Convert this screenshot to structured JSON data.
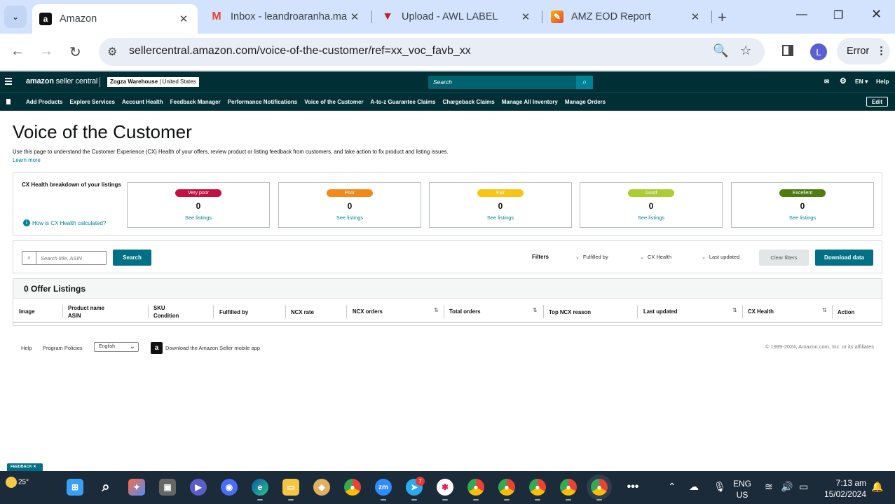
{
  "browser": {
    "tabs": [
      {
        "title": "Amazon",
        "icon": "amazon-icon",
        "active": true
      },
      {
        "title": "Inbox - leandroaranha.ma",
        "icon": "gmail-icon",
        "active": false
      },
      {
        "title": "Upload - AWL LABEL",
        "icon": "awl-icon",
        "active": false
      },
      {
        "title": "AMZ EOD Report",
        "icon": "sheets-icon",
        "active": false
      }
    ],
    "url": "sellercentral.amazon.com/voice-of-the-customer/ref=xx_voc_favb_xx",
    "profile_initial": "L",
    "error_label": "Error"
  },
  "header": {
    "logo_bold": "amazon",
    "logo_rest": " seller central",
    "store_name": "Zogza Warehouse",
    "store_region": " | United States",
    "search_placeholder": "Search",
    "lang": "EN",
    "help": "Help"
  },
  "nav": {
    "items": [
      "Add Products",
      "Explore Services",
      "Account Health",
      "Feedback Manager",
      "Performance Notifications",
      "Voice of the Customer",
      "A-to-z Guarantee Claims",
      "Chargeback Claims",
      "Manage All Inventory",
      "Manage Orders"
    ],
    "edit": "Edit"
  },
  "page": {
    "title": "Voice of the Customer",
    "description": "Use this page to understand the Customer Experience (CX) Health of your offers, review product or listing feedback from customers, and take action to fix product and listing issues.",
    "learn_more": "Learn more"
  },
  "health": {
    "label": "CX Health breakdown of your listings",
    "how_link": "How is CX Health calculated?",
    "cards": [
      {
        "label": "Very poor",
        "value": "0",
        "link": "See listings",
        "color": "#c40f41"
      },
      {
        "label": "Poor",
        "value": "0",
        "link": "See listings",
        "color": "#f3891a"
      },
      {
        "label": "Fair",
        "value": "0",
        "link": "See listings",
        "color": "#f7c614"
      },
      {
        "label": "Good",
        "value": "0",
        "link": "See listings",
        "color": "#a9cd32"
      },
      {
        "label": "Excellent",
        "value": "0",
        "link": "See listings",
        "color": "#4d7c0f"
      }
    ]
  },
  "filters": {
    "search_placeholder": "Search title, ASIN",
    "search_button": "Search",
    "label": "Filters",
    "dropdowns": [
      "Fulfilled by",
      "CX Health",
      "Last updated"
    ],
    "clear": "Clear filters",
    "download": "Download data"
  },
  "listings": {
    "title": "0 Offer Listings",
    "columns": [
      {
        "line1": "Image",
        "line2": ""
      },
      {
        "line1": "Product name",
        "line2": "ASIN"
      },
      {
        "line1": "SKU",
        "line2": "Condition"
      },
      {
        "line1": "Fulfilled by",
        "line2": ""
      },
      {
        "line1": "NCX rate",
        "line2": ""
      },
      {
        "line1": "NCX orders",
        "line2": ""
      },
      {
        "line1": "Total orders",
        "line2": ""
      },
      {
        "line1": "Top NCX reason",
        "line2": ""
      },
      {
        "line1": "Last updated",
        "line2": ""
      },
      {
        "line1": "CX Health",
        "line2": ""
      },
      {
        "line1": "Action",
        "line2": ""
      }
    ]
  },
  "footer": {
    "help": "Help",
    "policies": "Program Policies",
    "language": "English",
    "app_link": "Download the Amazon Seller mobile app",
    "copyright": "© 1999-2024, Amazon.com, Inc. or its affiliates"
  },
  "feedback_tab": "FEEDBACK ✕",
  "taskbar": {
    "temperature": "25°",
    "telegram_badge": "7",
    "lang_line1": "ENG",
    "lang_line2": "US",
    "time": "7:13 am",
    "date": "15/02/2024"
  }
}
